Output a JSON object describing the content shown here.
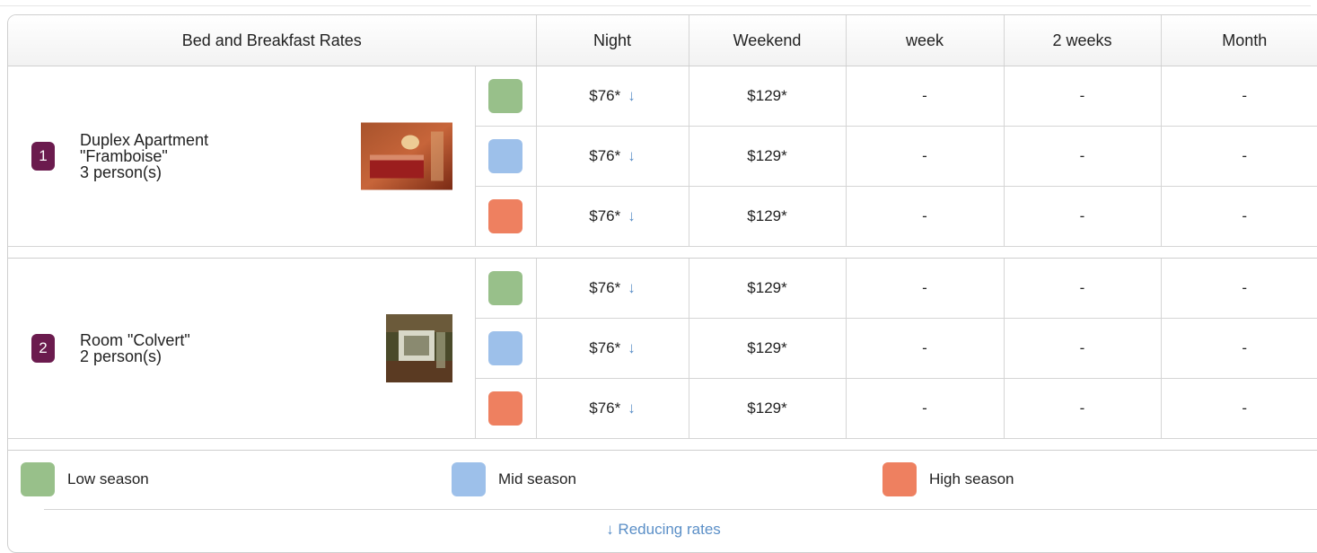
{
  "header": {
    "title": "Bed and Breakfast Rates",
    "columns": [
      "Night",
      "Weekend",
      "week",
      "2 weeks",
      "Month"
    ]
  },
  "rooms": [
    {
      "number": "1",
      "name_line1": "Duplex Apartment",
      "name_line2": "\"Framboise\"",
      "capacity": "3 person(s)",
      "rates": [
        {
          "season": "low",
          "night": "$76*",
          "weekend": "$129*",
          "week": "-",
          "two_weeks": "-",
          "month": "-"
        },
        {
          "season": "mid",
          "night": "$76*",
          "weekend": "$129*",
          "week": "-",
          "two_weeks": "-",
          "month": "-"
        },
        {
          "season": "high",
          "night": "$76*",
          "weekend": "$129*",
          "week": "-",
          "two_weeks": "-",
          "month": "-"
        }
      ]
    },
    {
      "number": "2",
      "name_line1": "Room \"Colvert\"",
      "name_line2": "",
      "capacity": "2 person(s)",
      "rates": [
        {
          "season": "low",
          "night": "$76*",
          "weekend": "$129*",
          "week": "-",
          "two_weeks": "-",
          "month": "-"
        },
        {
          "season": "mid",
          "night": "$76*",
          "weekend": "$129*",
          "week": "-",
          "two_weeks": "-",
          "month": "-"
        },
        {
          "season": "high",
          "night": "$76*",
          "weekend": "$129*",
          "week": "-",
          "two_weeks": "-",
          "month": "-"
        }
      ]
    }
  ],
  "arrow_icon": "↓",
  "legend": {
    "low": "Low season",
    "mid": "Mid season",
    "high": "High season",
    "note": "↓ Reducing rates"
  },
  "colors": {
    "low": "#98c08a",
    "mid": "#9dc0ea",
    "high": "#ee8060",
    "badge": "#6b1b4e",
    "link": "#5b8fc7"
  }
}
